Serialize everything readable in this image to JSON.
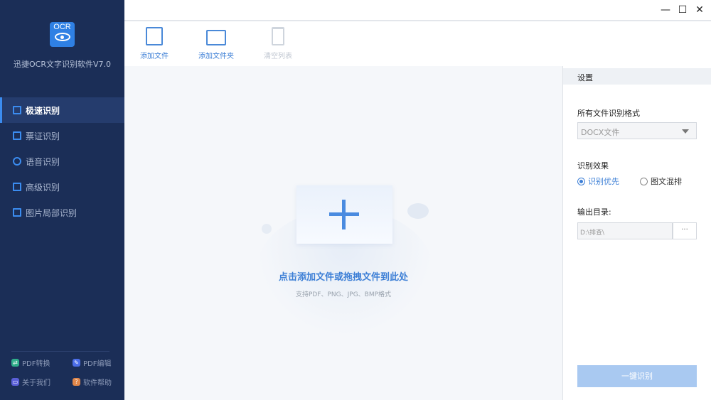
{
  "app": {
    "logo_text": "OCR",
    "title": "迅捷OCR文字识别软件V7.0"
  },
  "nav": [
    {
      "label": "极速识别",
      "active": true
    },
    {
      "label": "票证识别"
    },
    {
      "label": "语音识别"
    },
    {
      "label": "高级识别"
    },
    {
      "label": "图片局部识别"
    }
  ],
  "footer": [
    {
      "label": "PDF转换",
      "color": "#2fae8a"
    },
    {
      "label": "PDF编辑",
      "color": "#4c6ee8"
    },
    {
      "label": "关于我们",
      "color": "#5a5fd8"
    },
    {
      "label": "软件帮助",
      "color": "#e0874a"
    }
  ],
  "window": {
    "minimize": "—",
    "maximize": "☐",
    "close": "✕"
  },
  "toolbar": {
    "add_file": "添加文件",
    "add_folder": "添加文件夹",
    "clear_list": "清空列表"
  },
  "drop": {
    "hint": "点击添加文件或拖拽文件到此处",
    "formats": "支持PDF、PNG、JPG、BMP格式"
  },
  "settings": {
    "title": "设置",
    "format_label": "所有文件识别格式",
    "format_value": "DOCX文件",
    "effect_label": "识别效果",
    "effect_options": [
      "识别优先",
      "图文混排"
    ],
    "effect_selected": 0,
    "output_label": "输出目录:",
    "output_path": "D:\\排查\\",
    "browse": "···",
    "start": "一键识别"
  }
}
